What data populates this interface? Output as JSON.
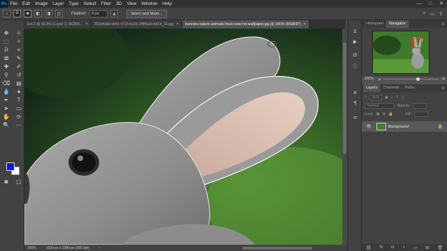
{
  "menubar": {
    "logo": "Ps",
    "items": [
      "File",
      "Edit",
      "Image",
      "Layer",
      "Type",
      "Select",
      "Filter",
      "3D",
      "View",
      "Window",
      "Help"
    ],
    "window_controls": [
      "—",
      "□",
      "✕"
    ]
  },
  "options": {
    "feather_label": "Feather:",
    "feather_value": "0 px",
    "select_mask_label": "Select and Mask..."
  },
  "tabs": [
    {
      "label": "led-1 @ 69.5% (Layer 2, RGB/8...",
      "active": false
    },
    {
      "label": "353e4a6e-bbfd-4714-b10c-2f8f6a9cdd14_15.jpg",
      "active": false
    },
    {
      "label": "bunnies-nature-animals-fresh-new-hd-wallpaper.jpg @ 200% (RGB/8*)",
      "active": true
    }
  ],
  "colors": {
    "foreground": "#1414e0",
    "background": "#ffffff"
  },
  "status": {
    "zoom": "200%",
    "doc_size": "1920 px x 1080 px (300 ppi)"
  },
  "navigator": {
    "tabs": [
      "Histogram",
      "Navigator"
    ],
    "active": "Navigator",
    "zoom": "200%"
  },
  "layers": {
    "tabs": [
      "Layers",
      "Channels",
      "Paths"
    ],
    "active": "Layers",
    "kind_placeholder": "Kind",
    "blend_mode": "Normal",
    "opacity_label": "Opacity:",
    "lock_label": "Lock:",
    "fill_label": "Fill:",
    "layer_name": "Background"
  }
}
